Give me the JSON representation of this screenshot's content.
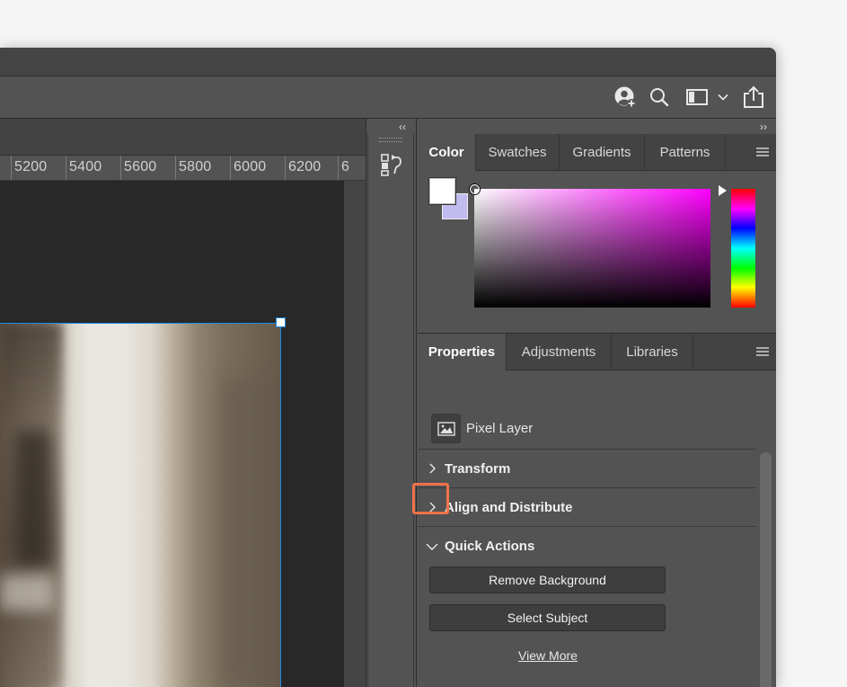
{
  "header_icons": {
    "account": "account-add-icon",
    "search": "search-icon",
    "workspace": "workspace-layout-icon",
    "workspace_dropdown": "chevron-down-icon",
    "share": "share-icon"
  },
  "ruler": {
    "labels": [
      "5200",
      "5400",
      "5600",
      "5800",
      "6000",
      "6200",
      "6"
    ]
  },
  "collapse": {
    "left": "‹‹",
    "right": "››"
  },
  "color_panel": {
    "tabs": [
      "Color",
      "Swatches",
      "Gradients",
      "Patterns"
    ],
    "active_tab": "Color",
    "foreground": "#ffffff",
    "background": "#c0bcf0",
    "hue": "#ff00ff"
  },
  "properties_panel": {
    "tabs": [
      "Properties",
      "Adjustments",
      "Libraries"
    ],
    "active_tab": "Properties",
    "layer_type": "Pixel Layer",
    "sections": [
      {
        "label": "Transform",
        "expanded": false
      },
      {
        "label": "Align and Distribute",
        "expanded": false
      },
      {
        "label": "Quick Actions",
        "expanded": true
      }
    ],
    "quick_actions": {
      "remove_background": "Remove Background",
      "select_subject": "Select Subject",
      "view_more": "View More"
    }
  },
  "colors": {
    "selection": "#1b8be6",
    "highlight": "#f0734a",
    "panel_bg": "#535353",
    "tab_bg": "#434343"
  }
}
